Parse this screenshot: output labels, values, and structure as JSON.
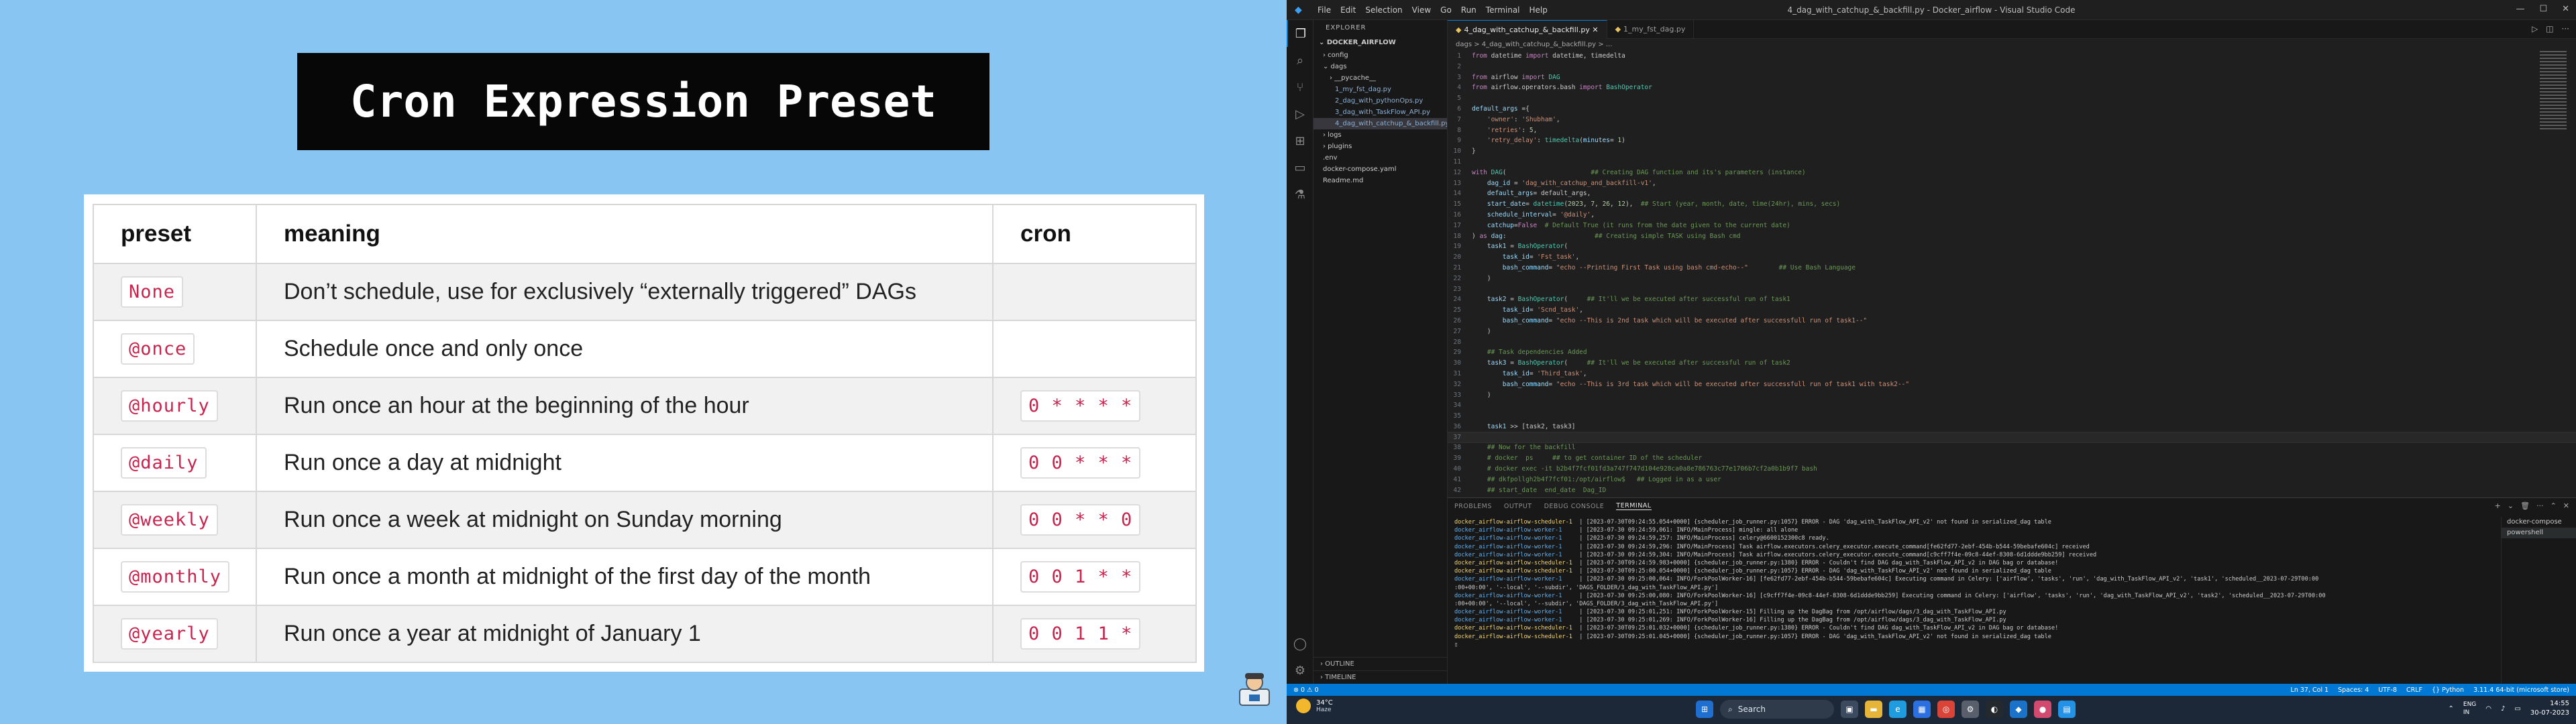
{
  "slide": {
    "title": "Cron Expression Preset",
    "headers": {
      "preset": "preset",
      "meaning": "meaning",
      "cron": "cron"
    },
    "rows": [
      {
        "preset": "None",
        "meaning": "Don’t schedule, use for exclusively “externally triggered” DAGs",
        "cron": ""
      },
      {
        "preset": "@once",
        "meaning": "Schedule once and only once",
        "cron": ""
      },
      {
        "preset": "@hourly",
        "meaning": "Run once an hour at the beginning of the hour",
        "cron": "0 * * * *"
      },
      {
        "preset": "@daily",
        "meaning": "Run once a day at midnight",
        "cron": "0 0 * * *"
      },
      {
        "preset": "@weekly",
        "meaning": "Run once a week at midnight on Sunday morning",
        "cron": "0 0 * * 0"
      },
      {
        "preset": "@monthly",
        "meaning": "Run once a month at midnight of the first day of the month",
        "cron": "0 0 1 * *"
      },
      {
        "preset": "@yearly",
        "meaning": "Run once a year at midnight of January 1",
        "cron": "0 0 1 1 *"
      }
    ]
  },
  "vscode": {
    "menu": [
      "File",
      "Edit",
      "Selection",
      "View",
      "Go",
      "Run",
      "Terminal",
      "Help"
    ],
    "window_title": "4_dag_with_catchup_&_backfill.py - Docker_airflow - Visual Studio Code",
    "explorer_title": "EXPLORER",
    "explorer_root": "DOCKER_AIRFLOW",
    "tree": [
      {
        "label": "› config",
        "indent": 14,
        "kind": "folder"
      },
      {
        "label": "⌄ dags",
        "indent": 14,
        "kind": "folder"
      },
      {
        "label": "› __pycache__",
        "indent": 24,
        "kind": "folder"
      },
      {
        "label": "1_my_fst_dag.py",
        "indent": 32,
        "kind": "py"
      },
      {
        "label": "2_dag_with_pythonOps.py",
        "indent": 32,
        "kind": "py"
      },
      {
        "label": "3_dag_with_TaskFlow_API.py",
        "indent": 32,
        "kind": "py"
      },
      {
        "label": "4_dag_with_catchup_&_backfill.py",
        "indent": 32,
        "kind": "py",
        "selected": true
      },
      {
        "label": "› logs",
        "indent": 14,
        "kind": "folder"
      },
      {
        "label": "› plugins",
        "indent": 14,
        "kind": "folder"
      },
      {
        "label": ".env",
        "indent": 14,
        "kind": "file"
      },
      {
        "label": "docker-compose.yaml",
        "indent": 14,
        "kind": "file"
      },
      {
        "label": "Readme.md",
        "indent": 14,
        "kind": "file"
      }
    ],
    "sidebar_sections": [
      "› OUTLINE",
      "› TIMELINE"
    ],
    "tabs": [
      {
        "label": "4_dag_with_catchup_&_backfill.py",
        "active": true
      },
      {
        "label": "1_my_fst_dag.py",
        "active": false
      }
    ],
    "breadcrumb": "dags > 4_dag_with_catchup_&_backfill.py > ...",
    "code": [
      {
        "n": "1",
        "html": "<span class='k'>from</span> datetime <span class='k'>import</span> datetime, timedelta"
      },
      {
        "n": "2",
        "html": ""
      },
      {
        "n": "3",
        "html": "<span class='k'>from</span> airflow <span class='k'>import</span> <span class='t'>DAG</span>"
      },
      {
        "n": "4",
        "html": "<span class='k'>from</span> airflow.operators.bash <span class='k'>import</span> <span class='t'>BashOperator</span>"
      },
      {
        "n": "5",
        "html": ""
      },
      {
        "n": "6",
        "html": "<span class='v'>default_args</span> ={"
      },
      {
        "n": "7",
        "html": "    <span class='s'>'owner'</span>: <span class='s'>'Shubham'</span>,"
      },
      {
        "n": "8",
        "html": "    <span class='s'>'retries'</span>: <span class='n'>5</span>,"
      },
      {
        "n": "9",
        "html": "    <span class='s'>'retry_delay'</span>: <span class='t'>timedelta</span>(<span class='v'>minutes</span>= <span class='n'>1</span>)"
      },
      {
        "n": "10",
        "html": "}"
      },
      {
        "n": "11",
        "html": ""
      },
      {
        "n": "12",
        "html": "<span class='k'>with</span> <span class='t'>DAG</span>(                      <span class='c'>## Creating DAG function and its's parameters (instance)</span>"
      },
      {
        "n": "13",
        "html": "    <span class='v'>dag_id</span> = <span class='s'>'dag_with_catchup_and_backfill-v1'</span>,"
      },
      {
        "n": "14",
        "html": "    <span class='v'>default_args</span>= default_args,"
      },
      {
        "n": "15",
        "html": "    <span class='v'>start_date</span>= <span class='t'>datetime</span>(<span class='n'>2023</span>, <span class='n'>7</span>, <span class='n'>26</span>, <span class='n'>12</span>),  <span class='c'>## Start (year, month, date, time(24hr), mins, secs)</span>"
      },
      {
        "n": "16",
        "html": "    <span class='v'>schedule_interval</span>= <span class='s'>'@daily'</span>,"
      },
      {
        "n": "17",
        "html": "    <span class='v'>catchup</span>=<span class='k'>False</span>  <span class='c'># Default True (it runs from the date given to the current date)</span>"
      },
      {
        "n": "18",
        "html": ") <span class='k'>as</span> <span class='v'>dag</span>:                       <span class='c'>## Creating simple TASK using Bash cmd</span>"
      },
      {
        "n": "19",
        "html": "    <span class='v'>task1</span> = <span class='t'>BashOperator</span>("
      },
      {
        "n": "20",
        "html": "        <span class='v'>task_id</span>= <span class='s'>'Fst_task'</span>,"
      },
      {
        "n": "21",
        "html": "        <span class='v'>bash_command</span>= <span class='s'>\"echo --Printing First Task using bash cmd-echo--\"</span>        <span class='c'>## Use Bash Language</span>"
      },
      {
        "n": "22",
        "html": "    )"
      },
      {
        "n": "23",
        "html": ""
      },
      {
        "n": "24",
        "html": "    <span class='v'>task2</span> = <span class='t'>BashOperator</span>(     <span class='c'>## It'll we be executed after successful run of task1</span>"
      },
      {
        "n": "25",
        "html": "        <span class='v'>task_id</span>= <span class='s'>'Scnd_task'</span>,"
      },
      {
        "n": "26",
        "html": "        <span class='v'>bash_command</span>= <span class='s'>\"echo --This is 2nd task which will be executed after successfull run of task1--\"</span>"
      },
      {
        "n": "27",
        "html": "    )"
      },
      {
        "n": "28",
        "html": ""
      },
      {
        "n": "29",
        "html": "    <span class='c'>## Task dependencies Added</span>"
      },
      {
        "n": "30",
        "html": "    <span class='v'>task3</span> = <span class='t'>BashOperator</span>(     <span class='c'>## It'll we be executed after successful run of task2</span>"
      },
      {
        "n": "31",
        "html": "        <span class='v'>task_id</span>= <span class='s'>'Third_task'</span>,"
      },
      {
        "n": "32",
        "html": "        <span class='v'>bash_command</span>= <span class='s'>\"echo --This is 3rd task which will be executed after successfull run of task1 with task2--\"</span>"
      },
      {
        "n": "33",
        "html": "    )"
      },
      {
        "n": "34",
        "html": ""
      },
      {
        "n": "35",
        "html": ""
      },
      {
        "n": "36",
        "html": "    <span class='v'>task1</span> &gt;&gt; [task2, task3]"
      },
      {
        "n": "37",
        "html": "",
        "current": true
      },
      {
        "n": "38",
        "html": "    <span class='c'>## Now for the backfill</span>"
      },
      {
        "n": "39",
        "html": "    <span class='c'># docker  ps     ## to get container ID of the scheduler</span>"
      },
      {
        "n": "40",
        "html": "    <span class='c'># docker exec -it b2b4f7fcf01fd3a747f747d104e928ca0a8e786763c77e1706b7cf2a0b1b9f7 bash</span>"
      },
      {
        "n": "41",
        "html": "    <span class='c'>## dkfpollgh2b4f7fcf01:/opt/airflow$   ## Logged in as a user</span>"
      },
      {
        "n": "42",
        "html": "    <span class='c'>## start_date  end_date  Dag_ID</span>"
      }
    ],
    "panel_tabs": [
      "PROBLEMS",
      "OUTPUT",
      "DEBUG CONSOLE",
      "TERMINAL"
    ],
    "terminal": [
      {
        "src": "docker_airflow-airflow-scheduler-1",
        "type": "sched",
        "msg": "  | [2023-07-30T09:24:55.054+0000] {scheduler_job_runner.py:1057} ERROR - DAG 'dag_with_TaskFlow_API_v2' not found in serialized_dag table"
      },
      {
        "src": "docker_airflow-airflow-worker-1",
        "type": "worker",
        "msg": "     | [2023-07-30 09:24:59,061: INFO/MainProcess] mingle: all alone"
      },
      {
        "src": "docker_airflow-airflow-worker-1",
        "type": "worker",
        "msg": "     | [2023-07-30 09:24:59,257: INFO/MainProcess] celery@6600152300c8 ready."
      },
      {
        "src": "docker_airflow-airflow-worker-1",
        "type": "worker",
        "msg": "     | [2023-07-30 09:24:59,296: INFO/MainProcess] Task airflow.executors.celery_executor.execute_command[fe62fd77-2ebf-454b-b544-59bebafe604c] received"
      },
      {
        "src": "docker_airflow-airflow-worker-1",
        "type": "worker",
        "msg": "     | [2023-07-30 09:24:59,304: INFO/MainProcess] Task airflow.executors.celery_executor.execute_command[c9cff7f4e-09c8-44ef-8308-6d1ddde9bb259] received"
      },
      {
        "src": "docker_airflow-airflow-scheduler-1",
        "type": "sched",
        "msg": "  | [2023-07-30T09:24:59.983+0000] {scheduler_job_runner.py:1380} ERROR - Couldn't find DAG dag_with_TaskFlow_API_v2 in DAG bag or database!"
      },
      {
        "src": "docker_airflow-airflow-scheduler-1",
        "type": "sched",
        "msg": "  | [2023-07-30T09:25:00.054+0000] {scheduler_job_runner.py:1057} ERROR - DAG 'dag_with_TaskFlow_API_v2' not found in serialized_dag table"
      },
      {
        "src": "docker_airflow-airflow-worker-1",
        "type": "worker",
        "msg": "     | [2023-07-30 09:25:00,064: INFO/ForkPoolWorker-16] [fe62fd77-2ebf-454b-b544-59bebafe604c] Executing command in Celery: ['airflow', 'tasks', 'run', 'dag_with_TaskFlow_API_v2', 'task1', 'scheduled__2023-07-29T00:00"
      },
      {
        "src": ":00+00:00', '--local', '--subdir', 'DAGS_FOLDER/3_dag_with_TaskFlow_API.py']",
        "type": "plain",
        "msg": ""
      },
      {
        "src": "docker_airflow-airflow-worker-1",
        "type": "worker",
        "msg": "     | [2023-07-30 09:25:00,080: INFO/ForkPoolWorker-16] [c9cff7f4e-09c8-44ef-8308-6d1ddde9bb259] Executing command in Celery: ['airflow', 'tasks', 'run', 'dag_with_TaskFlow_API_v2', 'task2', 'scheduled__2023-07-29T00:00"
      },
      {
        "src": ":00+00:00', '--local', '--subdir', 'DAGS_FOLDER/3_dag_with_TaskFlow_API.py']",
        "type": "plain",
        "msg": ""
      },
      {
        "src": "docker_airflow-airflow-worker-1",
        "type": "worker",
        "msg": "     | [2023-07-30 09:25:01,251: INFO/ForkPoolWorker-15] Filling up the DagBag from /opt/airflow/dags/3_dag_with_TaskFlow_API.py"
      },
      {
        "src": "docker_airflow-airflow-worker-1",
        "type": "worker",
        "msg": "     | [2023-07-30 09:25:01,269: INFO/ForkPoolWorker-16] Filling up the DagBag from /opt/airflow/dags/3_dag_with_TaskFlow_API.py"
      },
      {
        "src": "docker_airflow-airflow-scheduler-1",
        "type": "sched",
        "msg": "  | [2023-07-30T09:25:01.032+0000] {scheduler_job_runner.py:1380} ERROR - Couldn't find DAG dag_with_TaskFlow_API_v2 in DAG bag or database!"
      },
      {
        "src": "docker_airflow-airflow-scheduler-1",
        "type": "sched",
        "msg": "  | [2023-07-30T09:25:01.045+0000] {scheduler_job_runner.py:1057} ERROR - DAG 'dag_with_TaskFlow_API_v2' not found in serialized_dag table"
      }
    ],
    "terminal_list": [
      "docker-compose",
      "powershell"
    ],
    "status_left": "⊗ 0  ⚠ 0",
    "status_right": [
      "Ln 37, Col 1",
      "Spaces: 4",
      "UTF-8",
      "CRLF",
      "{} Python",
      "3.11.4 64-bit (microsoft store)"
    ]
  },
  "taskbar": {
    "weather_temp": "34°C",
    "weather_desc": "Haze",
    "search": "Search",
    "language": "ENG\nIN",
    "time": "14:55",
    "date": "30-07-2023"
  }
}
